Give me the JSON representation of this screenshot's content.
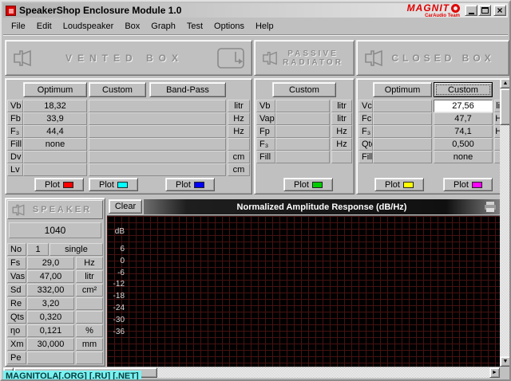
{
  "titlebar": {
    "title": "SpeakerShop Enclosure Module 1.0",
    "brand": "MAGNIT",
    "brand_sub": "CarAudio Team"
  },
  "icons": {
    "close": "×",
    "up": "▲",
    "down": "▼",
    "left": "◄",
    "right": "►"
  },
  "menu": {
    "items": [
      "File",
      "Edit",
      "Loudspeaker",
      "Box",
      "Graph",
      "Test",
      "Options",
      "Help"
    ]
  },
  "vented": {
    "header": "VENTED BOX",
    "tabs": [
      "Optimum",
      "Custom",
      "Band-Pass"
    ],
    "rows": [
      {
        "label": "Vb",
        "value": "18,32",
        "unit": "litr"
      },
      {
        "label": "Fb",
        "value": "33,9",
        "unit": "Hz"
      },
      {
        "label": "F₃",
        "value": "44,4",
        "unit": "Hz"
      },
      {
        "label": "Fill",
        "value": "none",
        "unit": ""
      },
      {
        "label": "Dv",
        "value": "",
        "unit": "cm"
      },
      {
        "label": "Lv",
        "value": "",
        "unit": "cm"
      }
    ],
    "plot_label": "Plot",
    "plot_colors": [
      "#ff0000",
      "#00ffff",
      "#0000ff"
    ]
  },
  "passive": {
    "header_line1": "PASSIVE",
    "header_line2": "RADIATOR",
    "tabs": [
      "Custom"
    ],
    "rows": [
      {
        "label": "Vb",
        "unit": "litr"
      },
      {
        "label": "Vap",
        "unit": "litr"
      },
      {
        "label": "Fp",
        "unit": "Hz"
      },
      {
        "label": "F₃",
        "unit": "Hz"
      },
      {
        "label": "Fill",
        "unit": ""
      }
    ],
    "plot_label": "Plot",
    "plot_colors": [
      "#00cc00"
    ]
  },
  "closed": {
    "header": "CLOSED BOX",
    "tabs": [
      "Optimum",
      "Custom"
    ],
    "rows": [
      {
        "label": "Vc",
        "value": "27,56",
        "unit": "litr"
      },
      {
        "label": "Fc",
        "value": "47,7",
        "unit": "Hz"
      },
      {
        "label": "F₃",
        "value": "74,1",
        "unit": "Hz"
      },
      {
        "label": "Qtc",
        "value": "0,500",
        "unit": ""
      },
      {
        "label": "Fill",
        "value": "none",
        "unit": ""
      }
    ],
    "plot_label": "Plot",
    "plot_colors": [
      "#ffff00",
      "#ff00ff"
    ]
  },
  "speaker": {
    "header": "SPEAKER",
    "model": "1040",
    "rows": [
      {
        "label": "No",
        "value": "1",
        "unit": "single"
      },
      {
        "label": "Fs",
        "value": "29,0",
        "unit": "Hz"
      },
      {
        "label": "Vas",
        "value": "47,00",
        "unit": "litr"
      },
      {
        "label": "Sd",
        "value": "332,00",
        "unit": "cm²"
      },
      {
        "label": "Re",
        "value": "3,20",
        "unit": ""
      },
      {
        "label": "Qts",
        "value": "0,320",
        "unit": ""
      },
      {
        "label": "ηo",
        "value": "0,121",
        "unit": "%"
      },
      {
        "label": "Xm",
        "value": "30,000",
        "unit": "mm"
      },
      {
        "label": "Pe",
        "value": "",
        "unit": ""
      }
    ]
  },
  "graph": {
    "clear_label": "Clear",
    "title": "Normalized Amplitude Response (dB/Hz)",
    "y_axis_labels": [
      "dB",
      "6",
      "0",
      "-6",
      "-12",
      "-18",
      "-24",
      "-30",
      "-36"
    ]
  },
  "watermark": "MAGNITOLA[.ORG] [.RU] [.NET]"
}
